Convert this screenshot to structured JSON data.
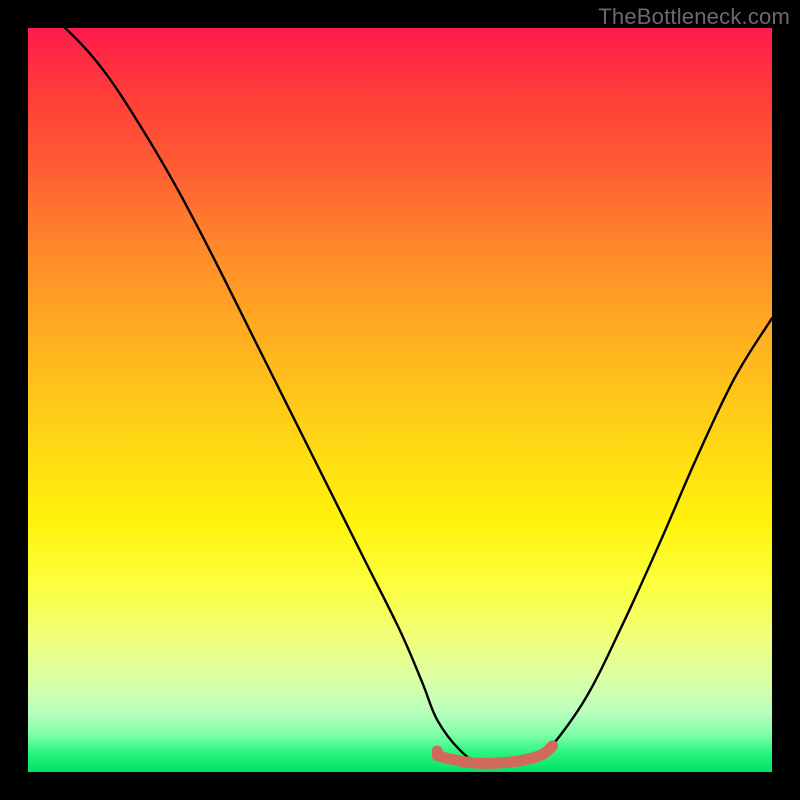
{
  "watermark": "TheBottleneck.com",
  "chart_data": {
    "type": "line",
    "title": "",
    "xlabel": "",
    "ylabel": "",
    "xlim": [
      0,
      100
    ],
    "ylim": [
      0,
      100
    ],
    "series": [
      {
        "name": "curve",
        "x": [
          0,
          5,
          10,
          15,
          20,
          25,
          30,
          35,
          40,
          45,
          50,
          53,
          55,
          58,
          61,
          65,
          68,
          70,
          75,
          80,
          85,
          90,
          95,
          100
        ],
        "y": [
          104,
          100,
          94.5,
          87,
          78.5,
          69,
          59,
          49,
          39,
          29,
          19,
          12,
          7,
          3,
          1,
          1,
          1.5,
          3,
          10,
          20,
          31,
          42.5,
          53,
          61
        ]
      },
      {
        "name": "highlight",
        "x": [
          55,
          57,
          60,
          63,
          66,
          69,
          70.5
        ],
        "y": [
          2.2,
          1.7,
          1.2,
          1.2,
          1.5,
          2.3,
          3.5
        ]
      }
    ],
    "highlight_dot": {
      "x": 55,
      "y": 2.8
    },
    "colors": {
      "curve": "#000000",
      "highlight": "#d26a5c"
    }
  }
}
